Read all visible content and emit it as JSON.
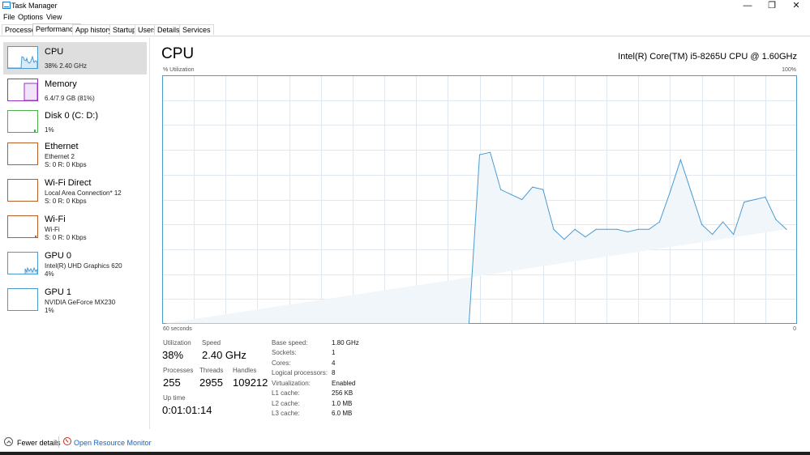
{
  "window": {
    "title": "Task Manager",
    "minimize": "—",
    "restore": "❐",
    "close": "✕"
  },
  "menu": [
    "File",
    "Options",
    "View"
  ],
  "tabs": [
    "Processes",
    "Performance",
    "App history",
    "Startup",
    "Users",
    "Details",
    "Services"
  ],
  "active_tab": "Performance",
  "colors": {
    "cpu": "#4a9bd1",
    "memory": "#9b30c5",
    "disk": "#4cb04a",
    "network": "#b9602a",
    "gpu": "#4a9bd1",
    "selected_bg": "#dedede",
    "graph_fill": "#f1f6fa",
    "link": "#1a63b8"
  },
  "sidebar": {
    "items": [
      {
        "title": "CPU",
        "subs": [
          "38%  2.40 GHz"
        ]
      },
      {
        "title": "Memory",
        "subs": [
          "6.4/7.9 GB (81%)"
        ]
      },
      {
        "title": "Disk 0 (C: D:)",
        "subs": [
          "1%"
        ]
      },
      {
        "title": "Ethernet",
        "subs": [
          "Ethernet 2",
          "S: 0  R: 0 Kbps"
        ]
      },
      {
        "title": "Wi-Fi Direct",
        "subs": [
          "Local Area Connection* 12",
          "S: 0  R: 0 Kbps"
        ]
      },
      {
        "title": "Wi-Fi",
        "subs": [
          "Wi-Fi",
          "S: 0  R: 0 Kbps"
        ]
      },
      {
        "title": "GPU 0",
        "subs": [
          "Intel(R) UHD Graphics 620",
          "4%"
        ]
      },
      {
        "title": "GPU 1",
        "subs": [
          "NVIDIA GeForce MX230",
          "1%"
        ]
      }
    ]
  },
  "main": {
    "title": "CPU",
    "cpu_name": "Intel(R) Core(TM) i5-8265U CPU @ 1.60GHz",
    "graph": {
      "ylabel": "% Utilization",
      "ymax_label": "100%",
      "xlabel_left": "60 seconds",
      "xlabel_right": "0"
    },
    "stats": {
      "utilization_label": "Utilization",
      "utilization": "38%",
      "speed_label": "Speed",
      "speed": "2.40 GHz",
      "processes_label": "Processes",
      "processes": "255",
      "threads_label": "Threads",
      "threads": "2955",
      "handles_label": "Handles",
      "handles": "109212",
      "uptime_label": "Up time",
      "uptime": "0:01:01:14"
    },
    "specs": [
      {
        "label": "Base speed:",
        "value": "1.80 GHz"
      },
      {
        "label": "Sockets:",
        "value": "1"
      },
      {
        "label": "Cores:",
        "value": "4"
      },
      {
        "label": "Logical processors:",
        "value": "8"
      },
      {
        "label": "Virtualization:",
        "value": "Enabled"
      },
      {
        "label": "L1 cache:",
        "value": "256 KB"
      },
      {
        "label": "L2 cache:",
        "value": "1.0 MB"
      },
      {
        "label": "L3 cache:",
        "value": "6.0 MB"
      }
    ]
  },
  "footer": {
    "fewer_details": "Fewer details",
    "open_monitor": "Open Resource Monitor"
  },
  "chart_data": {
    "type": "area",
    "x": [
      60,
      31,
      30,
      29,
      28,
      27,
      26,
      25,
      24,
      23,
      22,
      21,
      20,
      19,
      18,
      17,
      16,
      15,
      14,
      13,
      12,
      11,
      10,
      9,
      8,
      7,
      6,
      5,
      4,
      3,
      2,
      1,
      0
    ],
    "values": [
      0,
      0,
      68,
      69,
      54,
      52,
      50,
      55,
      54,
      38,
      34,
      38,
      35,
      38,
      38,
      38,
      37,
      38,
      38,
      41,
      53,
      66,
      53,
      40,
      36,
      41,
      36,
      49,
      50,
      51,
      42,
      38
    ],
    "ylim": [
      0,
      100
    ],
    "xlim": [
      60,
      0
    ],
    "grid": true
  }
}
